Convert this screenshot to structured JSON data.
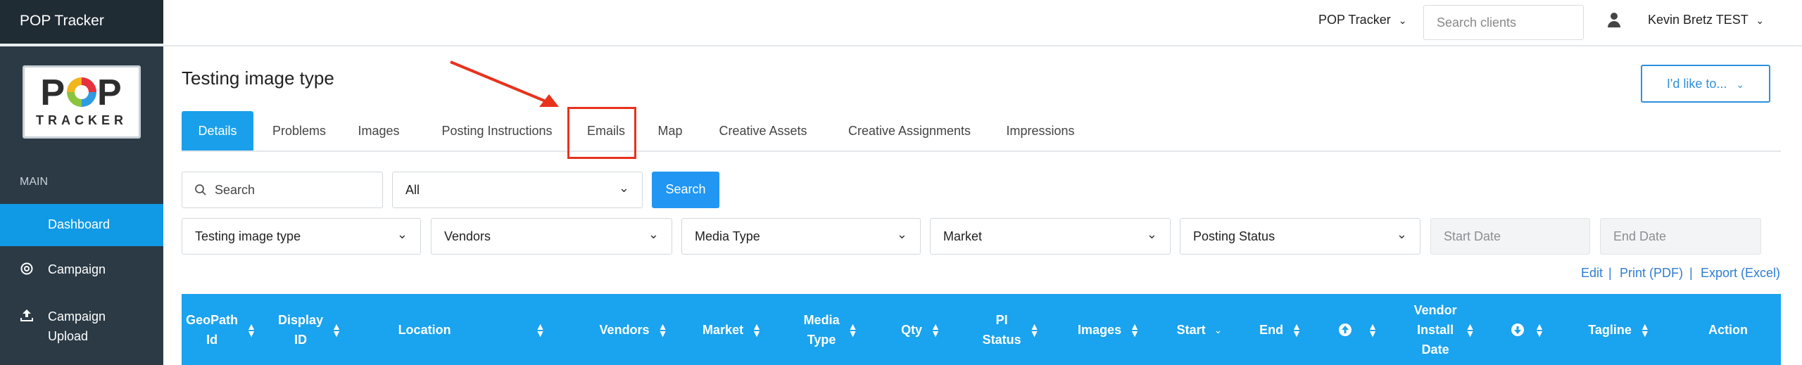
{
  "app": {
    "title": "POP Tracker"
  },
  "logo": {
    "line1_left": "P",
    "line1_right": "P",
    "line2": "TRACKER"
  },
  "sidebar": {
    "section_label": "MAIN",
    "items": [
      {
        "label": "Dashboard",
        "active": true
      },
      {
        "label": "Campaign",
        "icon": "target-icon"
      },
      {
        "label": "Campaign Upload",
        "icon": "upload-icon"
      }
    ]
  },
  "topbar": {
    "app_switcher": "POP Tracker",
    "search_placeholder": "Search clients",
    "user_name": "Kevin Bretz TEST"
  },
  "page": {
    "title": "Testing image type",
    "action_button": "I'd like to..."
  },
  "tabs": [
    "Details",
    "Problems",
    "Images",
    "Posting Instructions",
    "Emails",
    "Map",
    "Creative Assets",
    "Creative Assignments",
    "Impressions"
  ],
  "filters": {
    "search_placeholder": "Search",
    "status_select": "All",
    "search_button": "Search",
    "campaign": "Testing image type",
    "vendors": "Vendors",
    "media_type": "Media Type",
    "market": "Market",
    "posting_status": "Posting Status",
    "start_date": "Start Date",
    "end_date": "End Date"
  },
  "actions": {
    "edit": "Edit",
    "print": "Print (PDF)",
    "export": "Export (Excel)"
  },
  "table": {
    "columns": [
      {
        "line1": "GeoPath",
        "line2": "Id"
      },
      {
        "line1": "Display",
        "line2": "ID"
      },
      {
        "line1": "Location"
      },
      {
        "line1": "Vendors"
      },
      {
        "line1": "Market"
      },
      {
        "line1": "Media",
        "line2": "Type"
      },
      {
        "line1": "Qty"
      },
      {
        "line1": "PI",
        "line2": "Status"
      },
      {
        "line1": "Images"
      },
      {
        "line1": "Start"
      },
      {
        "line1": "End"
      },
      {
        "line1": ""
      },
      {
        "line1": "Vendor",
        "line2": "Install",
        "line3": "Date"
      },
      {
        "line1": ""
      },
      {
        "line1": "Tagline"
      },
      {
        "line1": "Action"
      }
    ]
  },
  "colors": {
    "sidebar": "#2b3a45",
    "accent": "#1aa0ea",
    "highlight": "#e8321c"
  }
}
